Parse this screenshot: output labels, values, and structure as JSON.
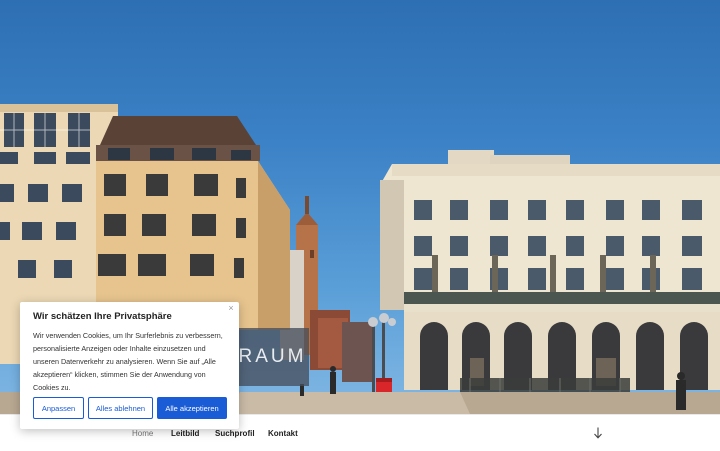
{
  "hero": {
    "brand_text": "RAUM"
  },
  "cookie_dialog": {
    "title": "Wir schätzen Ihre Privatsphäre",
    "body": "Wir verwenden Cookies, um Ihr Surferlebnis zu verbessern, personalisierte Anzeigen oder Inhalte einzusetzen und unseren Datenverkehr zu analysieren. Wenn Sie auf „Alle akzeptieren“ klicken, stimmen Sie der Anwendung von Cookies zu.",
    "close_label": "×",
    "buttons": {
      "customize": "Anpassen",
      "reject_all": "Alles ablehnen",
      "accept_all": "Alle akzeptieren"
    },
    "accent_color": "#1a5bd6"
  },
  "nav": {
    "items": [
      {
        "label": "Home"
      },
      {
        "label": "Leitbild"
      },
      {
        "label": "Suchprofil"
      },
      {
        "label": "Kontakt"
      }
    ],
    "scroll_icon": "arrow-down-icon"
  }
}
